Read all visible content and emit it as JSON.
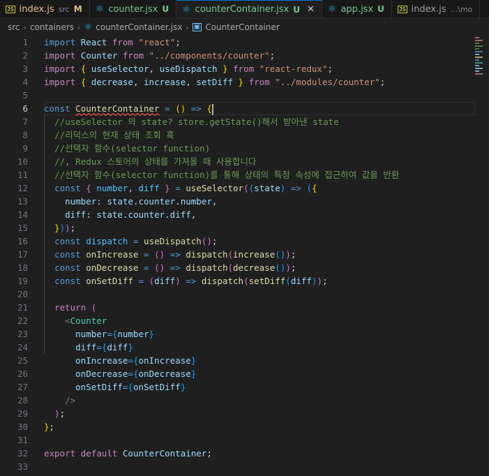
{
  "tabs": [
    {
      "icon": "js-icon",
      "name": "index.js",
      "sub": "src",
      "status": "M",
      "status_type": "mod",
      "active": false
    },
    {
      "icon": "react-icon",
      "name": "counter.jsx",
      "sub": "",
      "status": "U",
      "status_type": "new",
      "active": false
    },
    {
      "icon": "react-icon",
      "name": "counterContainer.jsx",
      "sub": "",
      "status": "U",
      "status_type": "new",
      "active": true
    },
    {
      "icon": "react-icon",
      "name": "app.jsx",
      "sub": "",
      "status": "U",
      "status_type": "new",
      "active": false
    },
    {
      "icon": "js-icon",
      "name": "index.js",
      "sub": "...\\mo",
      "status": "",
      "status_type": "",
      "active": false
    }
  ],
  "breadcrumb": {
    "root": "src",
    "folder": "containers",
    "file": "counterContainer.jsx",
    "symbol": "CounterContainer"
  },
  "editor": {
    "current_line": 6,
    "line_numbers": [
      "1",
      "2",
      "3",
      "4",
      "5",
      "6",
      "7",
      "8",
      "9",
      "10",
      "11",
      "12",
      "13",
      "14",
      "15",
      "16",
      "17",
      "18",
      "19",
      "20",
      "21",
      "22",
      "23",
      "24",
      "25",
      "26",
      "27",
      "28",
      "29",
      "30",
      "31",
      "32",
      "33"
    ],
    "lines": [
      [
        [
          "kw",
          "import"
        ],
        [
          "pun",
          " "
        ],
        [
          "var",
          "React"
        ],
        [
          "pun",
          " "
        ],
        [
          "ctl",
          "from"
        ],
        [
          "pun",
          " "
        ],
        [
          "str",
          "\"react\""
        ],
        [
          "pun",
          ";"
        ]
      ],
      [
        [
          "ctl",
          "import"
        ],
        [
          "pun",
          " "
        ],
        [
          "var",
          "Counter"
        ],
        [
          "pun",
          " "
        ],
        [
          "ctl",
          "from"
        ],
        [
          "pun",
          " "
        ],
        [
          "str",
          "\"../components/counter\""
        ],
        [
          "pun",
          ";"
        ]
      ],
      [
        [
          "ctl",
          "import"
        ],
        [
          "pun",
          " "
        ],
        [
          "br1",
          "{"
        ],
        [
          "pun",
          " "
        ],
        [
          "var",
          "useSelector"
        ],
        [
          "pun",
          ", "
        ],
        [
          "var",
          "useDispatch"
        ],
        [
          "pun",
          " "
        ],
        [
          "br1",
          "}"
        ],
        [
          "pun",
          " "
        ],
        [
          "ctl",
          "from"
        ],
        [
          "pun",
          " "
        ],
        [
          "str",
          "\"react-redux\""
        ],
        [
          "pun",
          ";"
        ]
      ],
      [
        [
          "ctl",
          "import"
        ],
        [
          "pun",
          " "
        ],
        [
          "br1",
          "{"
        ],
        [
          "pun",
          " "
        ],
        [
          "var",
          "decrease"
        ],
        [
          "pun",
          ", "
        ],
        [
          "var",
          "increase"
        ],
        [
          "pun",
          ", "
        ],
        [
          "var",
          "setDiff"
        ],
        [
          "pun",
          " "
        ],
        [
          "br1",
          "}"
        ],
        [
          "pun",
          " "
        ],
        [
          "ctl",
          "from"
        ],
        [
          "pun",
          " "
        ],
        [
          "str",
          "\"../modules/counter\""
        ],
        [
          "pun",
          ";"
        ]
      ],
      [],
      [
        [
          "kw",
          "const"
        ],
        [
          "pun",
          " "
        ],
        [
          "fn squiggle",
          "CounterContainer"
        ],
        [
          "pun",
          " "
        ],
        [
          "kw",
          "="
        ],
        [
          "pun",
          " "
        ],
        [
          "br1",
          "()"
        ],
        [
          "pun",
          " "
        ],
        [
          "kw",
          "=>"
        ],
        [
          "pun",
          " "
        ],
        [
          "br1",
          "{"
        ],
        [
          "cursor",
          ""
        ]
      ],
      [
        [
          "pun",
          "  "
        ],
        [
          "cmt",
          "//useSelector 의 state? store.getState()해서 받아낸 state"
        ]
      ],
      [
        [
          "pun",
          "  "
        ],
        [
          "cmt",
          "//리덕스의 현재 상태 조회 훅"
        ]
      ],
      [
        [
          "pun",
          "  "
        ],
        [
          "cmt",
          "//선택자 함수(selector function)"
        ]
      ],
      [
        [
          "pun",
          "  "
        ],
        [
          "cmt",
          "//, Redux 스토어의 상태를 가져올 때 사용합니다"
        ]
      ],
      [
        [
          "pun",
          "  "
        ],
        [
          "cmt",
          "//선택자 함수(selector function)를 통해 상태의 특정 속성에 접근하여 값을 반환"
        ]
      ],
      [
        [
          "pun",
          "  "
        ],
        [
          "kw",
          "const"
        ],
        [
          "pun",
          " "
        ],
        [
          "br2",
          "{"
        ],
        [
          "pun",
          " "
        ],
        [
          "cst",
          "number"
        ],
        [
          "pun",
          ", "
        ],
        [
          "cst",
          "diff"
        ],
        [
          "pun",
          " "
        ],
        [
          "br2",
          "}"
        ],
        [
          "pun",
          " "
        ],
        [
          "kw",
          "="
        ],
        [
          "pun",
          " "
        ],
        [
          "fn",
          "useSelector"
        ],
        [
          "br2",
          "("
        ],
        [
          "br3",
          "("
        ],
        [
          "var",
          "state"
        ],
        [
          "br3",
          ")"
        ],
        [
          "pun",
          " "
        ],
        [
          "kw",
          "=>"
        ],
        [
          "pun",
          " "
        ],
        [
          "br3",
          "("
        ],
        [
          "br1",
          "{"
        ]
      ],
      [
        [
          "pun",
          "    "
        ],
        [
          "var",
          "number"
        ],
        [
          "pun",
          ": "
        ],
        [
          "var",
          "state"
        ],
        [
          "pun",
          "."
        ],
        [
          "var",
          "counter"
        ],
        [
          "pun",
          "."
        ],
        [
          "var",
          "number"
        ],
        [
          "pun",
          ","
        ]
      ],
      [
        [
          "pun",
          "    "
        ],
        [
          "var",
          "diff"
        ],
        [
          "pun",
          ": "
        ],
        [
          "var",
          "state"
        ],
        [
          "pun",
          "."
        ],
        [
          "var",
          "counter"
        ],
        [
          "pun",
          "."
        ],
        [
          "var",
          "diff"
        ],
        [
          "pun",
          ","
        ]
      ],
      [
        [
          "pun",
          "  "
        ],
        [
          "br1",
          "}"
        ],
        [
          "br3",
          ")"
        ],
        [
          "br2",
          ")"
        ],
        [
          "pun",
          ";"
        ]
      ],
      [
        [
          "pun",
          "  "
        ],
        [
          "kw",
          "const"
        ],
        [
          "pun",
          " "
        ],
        [
          "cst",
          "dispatch"
        ],
        [
          "pun",
          " "
        ],
        [
          "kw",
          "="
        ],
        [
          "pun",
          " "
        ],
        [
          "fn",
          "useDispatch"
        ],
        [
          "br2",
          "()"
        ],
        [
          "pun",
          ";"
        ]
      ],
      [
        [
          "pun",
          "  "
        ],
        [
          "kw",
          "const"
        ],
        [
          "pun",
          " "
        ],
        [
          "fn",
          "onIncrease"
        ],
        [
          "pun",
          " "
        ],
        [
          "kw",
          "="
        ],
        [
          "pun",
          " "
        ],
        [
          "br2",
          "()"
        ],
        [
          "pun",
          " "
        ],
        [
          "kw",
          "=>"
        ],
        [
          "pun",
          " "
        ],
        [
          "fn",
          "dispatch"
        ],
        [
          "br2",
          "("
        ],
        [
          "fn",
          "increase"
        ],
        [
          "br3",
          "()"
        ],
        [
          "br2",
          ")"
        ],
        [
          "pun",
          ";"
        ]
      ],
      [
        [
          "pun",
          "  "
        ],
        [
          "kw",
          "const"
        ],
        [
          "pun",
          " "
        ],
        [
          "fn",
          "onDecrease"
        ],
        [
          "pun",
          " "
        ],
        [
          "kw",
          "="
        ],
        [
          "pun",
          " "
        ],
        [
          "br2",
          "()"
        ],
        [
          "pun",
          " "
        ],
        [
          "kw",
          "=>"
        ],
        [
          "pun",
          " "
        ],
        [
          "fn",
          "dispatch"
        ],
        [
          "br2",
          "("
        ],
        [
          "fn",
          "decrease"
        ],
        [
          "br3",
          "()"
        ],
        [
          "br2",
          ")"
        ],
        [
          "pun",
          ";"
        ]
      ],
      [
        [
          "pun",
          "  "
        ],
        [
          "kw",
          "const"
        ],
        [
          "pun",
          " "
        ],
        [
          "fn",
          "onSetDiff"
        ],
        [
          "pun",
          " "
        ],
        [
          "kw",
          "="
        ],
        [
          "pun",
          " "
        ],
        [
          "br2",
          "("
        ],
        [
          "var",
          "diff"
        ],
        [
          "br2",
          ")"
        ],
        [
          "pun",
          " "
        ],
        [
          "kw",
          "=>"
        ],
        [
          "pun",
          " "
        ],
        [
          "fn",
          "dispatch"
        ],
        [
          "br2",
          "("
        ],
        [
          "fn",
          "setDiff"
        ],
        [
          "br3",
          "("
        ],
        [
          "var",
          "diff"
        ],
        [
          "br3",
          ")"
        ],
        [
          "br2",
          ")"
        ],
        [
          "pun",
          ";"
        ]
      ],
      [],
      [
        [
          "pun",
          "  "
        ],
        [
          "ctl",
          "return"
        ],
        [
          "pun",
          " "
        ],
        [
          "br2",
          "("
        ]
      ],
      [
        [
          "pun",
          "    "
        ],
        [
          "jsx",
          "<"
        ],
        [
          "tag",
          "Counter"
        ]
      ],
      [
        [
          "pun",
          "      "
        ],
        [
          "attr",
          "number"
        ],
        [
          "kw",
          "="
        ],
        [
          "br3",
          "{"
        ],
        [
          "var",
          "number"
        ],
        [
          "br3",
          "}"
        ]
      ],
      [
        [
          "pun",
          "      "
        ],
        [
          "attr",
          "diff"
        ],
        [
          "kw",
          "="
        ],
        [
          "br3",
          "{"
        ],
        [
          "var",
          "diff"
        ],
        [
          "br3",
          "}"
        ]
      ],
      [
        [
          "pun",
          "      "
        ],
        [
          "attr",
          "onIncrease"
        ],
        [
          "kw",
          "="
        ],
        [
          "br3",
          "{"
        ],
        [
          "var",
          "onIncrease"
        ],
        [
          "br3",
          "}"
        ]
      ],
      [
        [
          "pun",
          "      "
        ],
        [
          "attr",
          "onDecrease"
        ],
        [
          "kw",
          "="
        ],
        [
          "br3",
          "{"
        ],
        [
          "var",
          "onDecrease"
        ],
        [
          "br3",
          "}"
        ]
      ],
      [
        [
          "pun",
          "      "
        ],
        [
          "attr",
          "onSetDiff"
        ],
        [
          "kw",
          "="
        ],
        [
          "br3",
          "{"
        ],
        [
          "var",
          "onSetDiff"
        ],
        [
          "br3",
          "}"
        ]
      ],
      [
        [
          "pun",
          "    "
        ],
        [
          "jsx",
          "/>"
        ]
      ],
      [
        [
          "pun",
          "  "
        ],
        [
          "br2",
          ")"
        ],
        [
          "pun",
          ";"
        ]
      ],
      [
        [
          "br1",
          "}"
        ],
        [
          "pun",
          ";"
        ]
      ],
      [],
      [
        [
          "ctl",
          "export"
        ],
        [
          "pun",
          " "
        ],
        [
          "ctl",
          "default"
        ],
        [
          "pun",
          " "
        ],
        [
          "var",
          "CounterContainer"
        ],
        [
          "pun",
          ";"
        ]
      ],
      []
    ]
  },
  "minimap_colors": [
    "#c586c0",
    "#ce9178",
    "#6a9955",
    "#6a9955",
    "#6a9955",
    "#569cd6",
    "#9cdcfe",
    "#dcdcaa",
    "#569cd6",
    "#4ec9b0",
    "#9cdcfe",
    "#9cdcfe",
    "#9cdcfe",
    "#c586c0"
  ]
}
